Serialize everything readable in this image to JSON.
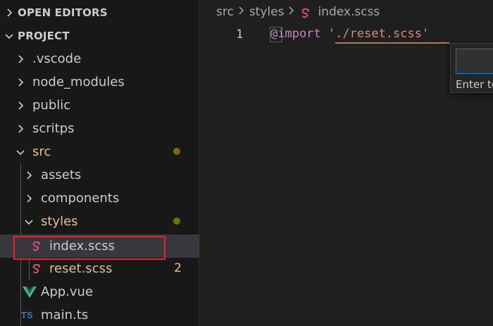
{
  "sidebar": {
    "open_editors_label": "OPEN EDITORS",
    "project_label": "PROJECT",
    "items": [
      {
        "name": ".vscode"
      },
      {
        "name": "node_modules"
      },
      {
        "name": "public"
      },
      {
        "name": "scritps"
      },
      {
        "name": "src"
      },
      {
        "name": "assets"
      },
      {
        "name": "components"
      },
      {
        "name": "styles"
      },
      {
        "name": "index.scss"
      },
      {
        "name": "reset.scss",
        "badge": "2"
      },
      {
        "name": "App.vue"
      },
      {
        "name": "main.ts",
        "icon_text": "TS"
      }
    ]
  },
  "editor": {
    "breadcrumb": [
      "src",
      "styles",
      "index.scss"
    ],
    "line_number": "1",
    "code_keyword": "@import",
    "code_string": "'./reset.scss'"
  },
  "popup": {
    "hint": "Enter to"
  },
  "colors": {
    "accent": "#0078d4",
    "modified": "#e2c08d",
    "sass": "#f55385",
    "vue_green": "#41b883",
    "ts_blue": "#3178c6",
    "highlight": "#e5262b"
  },
  "icons": {
    "chevron_right": "chevron-right-icon",
    "chevron_down": "chevron-down-icon",
    "sass": "sass-file-icon",
    "vue": "vue-file-icon",
    "ts": "typescript-file-icon"
  }
}
